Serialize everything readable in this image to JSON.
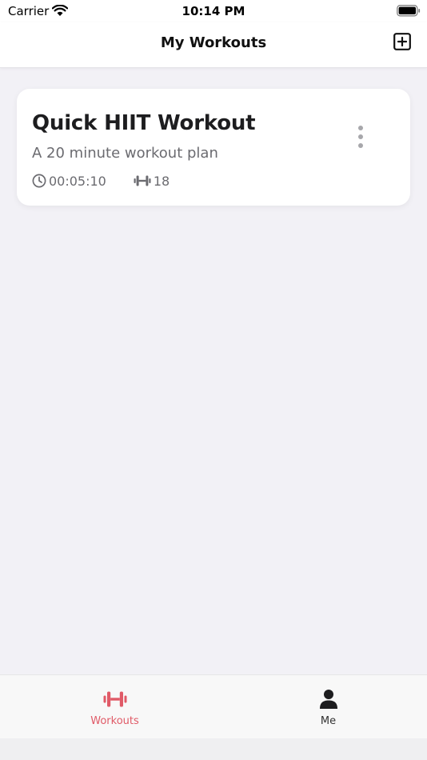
{
  "status_bar": {
    "carrier": "Carrier",
    "time": "10:14 PM"
  },
  "nav": {
    "title": "My Workouts",
    "add_icon": "plus-square-icon"
  },
  "workouts": [
    {
      "title": "Quick HIIT Workout",
      "subtitle": "A 20 minute workout plan",
      "duration": "00:05:10",
      "exercise_count": "18"
    }
  ],
  "tabs": [
    {
      "label": "Workouts",
      "icon": "dumbbell-icon",
      "active": true
    },
    {
      "label": "Me",
      "icon": "person-icon",
      "active": false
    }
  ],
  "colors": {
    "accent": "#e05a67",
    "background": "#f2f1f6",
    "card": "#ffffff",
    "secondary_text": "#6b6b70"
  }
}
